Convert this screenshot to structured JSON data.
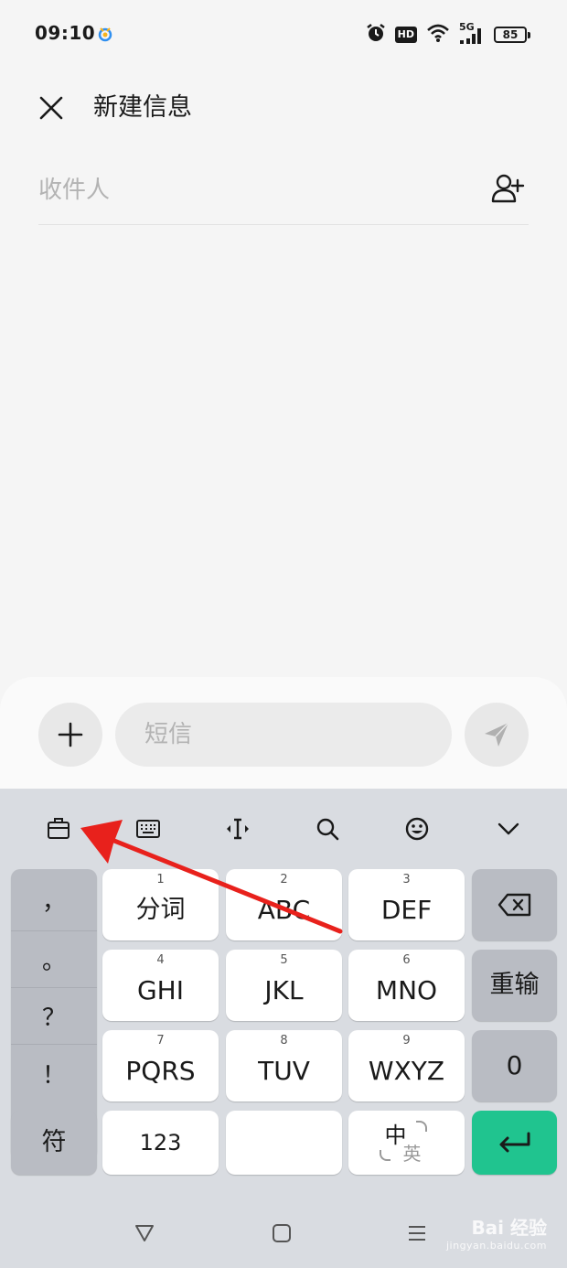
{
  "status_bar": {
    "time": "09:10",
    "hd": "HD",
    "network": "5G",
    "battery": "85"
  },
  "header": {
    "title": "新建信息"
  },
  "recipient": {
    "placeholder": "收件人"
  },
  "compose": {
    "placeholder": "短信"
  },
  "keyboard": {
    "punct_keys": [
      "，",
      "。",
      "？",
      "！"
    ],
    "symbol_key": "符",
    "t9_keys": [
      {
        "num": "1",
        "label": "分词"
      },
      {
        "num": "2",
        "label": "ABC"
      },
      {
        "num": "3",
        "label": "DEF"
      },
      {
        "num": "4",
        "label": "GHI"
      },
      {
        "num": "5",
        "label": "JKL"
      },
      {
        "num": "6",
        "label": "MNO"
      },
      {
        "num": "7",
        "label": "PQRS"
      },
      {
        "num": "8",
        "label": "TUV"
      },
      {
        "num": "9",
        "label": "WXYZ"
      }
    ],
    "reenter_key": "重输",
    "zero_key": "0",
    "num_switch_key": "123",
    "lang_zh": "中",
    "lang_en": "英"
  },
  "watermark": {
    "brand": "Bai 经验",
    "url": "jingyan.baidu.com"
  },
  "colors": {
    "accent_green": "#20c48f",
    "annotation_red": "#e8211c"
  }
}
